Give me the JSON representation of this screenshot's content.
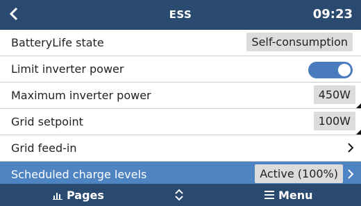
{
  "header": {
    "title": "ESS",
    "time": "09:23",
    "back_icon": "chevron-left-icon"
  },
  "rows": [
    {
      "label": "BatteryLife state",
      "value": "Self-consumption"
    },
    {
      "label": "Limit inverter power",
      "toggle_on": true
    },
    {
      "label": "Maximum inverter power",
      "value": "450W"
    },
    {
      "label": "Grid setpoint",
      "value": "100W"
    },
    {
      "label": "Grid feed-in"
    },
    {
      "label": "Scheduled charge levels",
      "value": "Active (100%)",
      "selected": true
    }
  ],
  "footer": {
    "pages_label": "Pages",
    "menu_label": "Menu",
    "pages_icon": "bar-chart-icon",
    "center_icon": "up-down-chevron-icon",
    "menu_icon": "hamburger-menu-icon"
  },
  "colors": {
    "header_bg": "#2b4a6f",
    "selected_bg": "#4f84c2",
    "toggle_on": "#4a7bbd"
  }
}
